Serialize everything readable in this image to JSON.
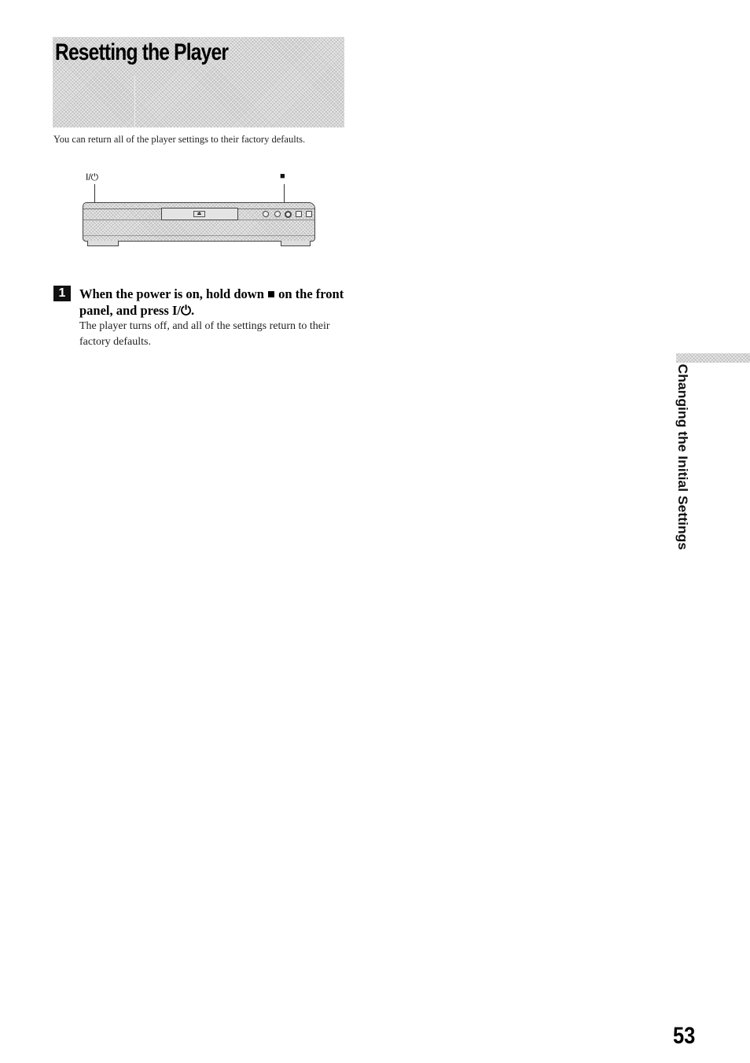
{
  "section": {
    "title": "Resetting the Player",
    "intro": "You can return all of the player settings to their factory defaults."
  },
  "illustration": {
    "label_power": "I/⏻",
    "label_stop": "■",
    "eject_symbol": "⏏"
  },
  "steps": [
    {
      "number": "1",
      "heading": "When the power is on, hold down ■ on the front panel, and press I/⏻.",
      "body": "The player turns off, and all of the settings return to their factory defaults."
    }
  ],
  "side_tab": {
    "label": "Changing the Initial Settings"
  },
  "page_number": "53"
}
